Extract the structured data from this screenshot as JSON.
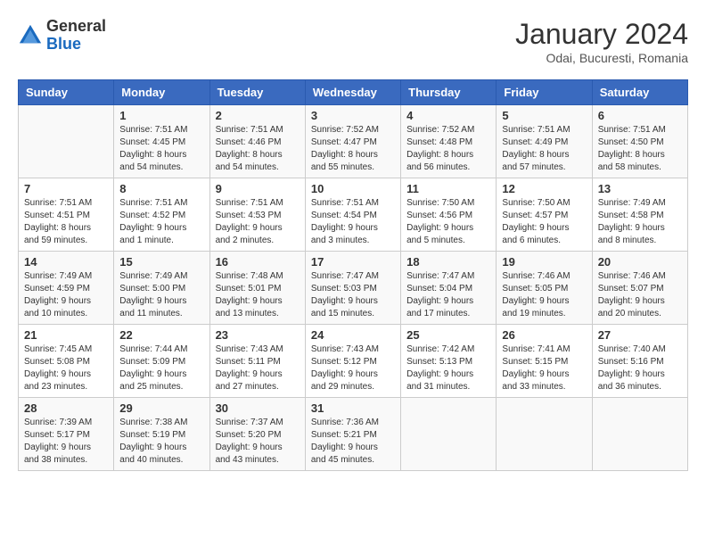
{
  "header": {
    "logo_general": "General",
    "logo_blue": "Blue",
    "month_year": "January 2024",
    "location": "Odai, Bucuresti, Romania"
  },
  "weekdays": [
    "Sunday",
    "Monday",
    "Tuesday",
    "Wednesday",
    "Thursday",
    "Friday",
    "Saturday"
  ],
  "weeks": [
    [
      {
        "day": "",
        "info": ""
      },
      {
        "day": "1",
        "info": "Sunrise: 7:51 AM\nSunset: 4:45 PM\nDaylight: 8 hours\nand 54 minutes."
      },
      {
        "day": "2",
        "info": "Sunrise: 7:51 AM\nSunset: 4:46 PM\nDaylight: 8 hours\nand 54 minutes."
      },
      {
        "day": "3",
        "info": "Sunrise: 7:52 AM\nSunset: 4:47 PM\nDaylight: 8 hours\nand 55 minutes."
      },
      {
        "day": "4",
        "info": "Sunrise: 7:52 AM\nSunset: 4:48 PM\nDaylight: 8 hours\nand 56 minutes."
      },
      {
        "day": "5",
        "info": "Sunrise: 7:51 AM\nSunset: 4:49 PM\nDaylight: 8 hours\nand 57 minutes."
      },
      {
        "day": "6",
        "info": "Sunrise: 7:51 AM\nSunset: 4:50 PM\nDaylight: 8 hours\nand 58 minutes."
      }
    ],
    [
      {
        "day": "7",
        "info": "Sunrise: 7:51 AM\nSunset: 4:51 PM\nDaylight: 8 hours\nand 59 minutes."
      },
      {
        "day": "8",
        "info": "Sunrise: 7:51 AM\nSunset: 4:52 PM\nDaylight: 9 hours\nand 1 minute."
      },
      {
        "day": "9",
        "info": "Sunrise: 7:51 AM\nSunset: 4:53 PM\nDaylight: 9 hours\nand 2 minutes."
      },
      {
        "day": "10",
        "info": "Sunrise: 7:51 AM\nSunset: 4:54 PM\nDaylight: 9 hours\nand 3 minutes."
      },
      {
        "day": "11",
        "info": "Sunrise: 7:50 AM\nSunset: 4:56 PM\nDaylight: 9 hours\nand 5 minutes."
      },
      {
        "day": "12",
        "info": "Sunrise: 7:50 AM\nSunset: 4:57 PM\nDaylight: 9 hours\nand 6 minutes."
      },
      {
        "day": "13",
        "info": "Sunrise: 7:49 AM\nSunset: 4:58 PM\nDaylight: 9 hours\nand 8 minutes."
      }
    ],
    [
      {
        "day": "14",
        "info": "Sunrise: 7:49 AM\nSunset: 4:59 PM\nDaylight: 9 hours\nand 10 minutes."
      },
      {
        "day": "15",
        "info": "Sunrise: 7:49 AM\nSunset: 5:00 PM\nDaylight: 9 hours\nand 11 minutes."
      },
      {
        "day": "16",
        "info": "Sunrise: 7:48 AM\nSunset: 5:01 PM\nDaylight: 9 hours\nand 13 minutes."
      },
      {
        "day": "17",
        "info": "Sunrise: 7:47 AM\nSunset: 5:03 PM\nDaylight: 9 hours\nand 15 minutes."
      },
      {
        "day": "18",
        "info": "Sunrise: 7:47 AM\nSunset: 5:04 PM\nDaylight: 9 hours\nand 17 minutes."
      },
      {
        "day": "19",
        "info": "Sunrise: 7:46 AM\nSunset: 5:05 PM\nDaylight: 9 hours\nand 19 minutes."
      },
      {
        "day": "20",
        "info": "Sunrise: 7:46 AM\nSunset: 5:07 PM\nDaylight: 9 hours\nand 20 minutes."
      }
    ],
    [
      {
        "day": "21",
        "info": "Sunrise: 7:45 AM\nSunset: 5:08 PM\nDaylight: 9 hours\nand 23 minutes."
      },
      {
        "day": "22",
        "info": "Sunrise: 7:44 AM\nSunset: 5:09 PM\nDaylight: 9 hours\nand 25 minutes."
      },
      {
        "day": "23",
        "info": "Sunrise: 7:43 AM\nSunset: 5:11 PM\nDaylight: 9 hours\nand 27 minutes."
      },
      {
        "day": "24",
        "info": "Sunrise: 7:43 AM\nSunset: 5:12 PM\nDaylight: 9 hours\nand 29 minutes."
      },
      {
        "day": "25",
        "info": "Sunrise: 7:42 AM\nSunset: 5:13 PM\nDaylight: 9 hours\nand 31 minutes."
      },
      {
        "day": "26",
        "info": "Sunrise: 7:41 AM\nSunset: 5:15 PM\nDaylight: 9 hours\nand 33 minutes."
      },
      {
        "day": "27",
        "info": "Sunrise: 7:40 AM\nSunset: 5:16 PM\nDaylight: 9 hours\nand 36 minutes."
      }
    ],
    [
      {
        "day": "28",
        "info": "Sunrise: 7:39 AM\nSunset: 5:17 PM\nDaylight: 9 hours\nand 38 minutes."
      },
      {
        "day": "29",
        "info": "Sunrise: 7:38 AM\nSunset: 5:19 PM\nDaylight: 9 hours\nand 40 minutes."
      },
      {
        "day": "30",
        "info": "Sunrise: 7:37 AM\nSunset: 5:20 PM\nDaylight: 9 hours\nand 43 minutes."
      },
      {
        "day": "31",
        "info": "Sunrise: 7:36 AM\nSunset: 5:21 PM\nDaylight: 9 hours\nand 45 minutes."
      },
      {
        "day": "",
        "info": ""
      },
      {
        "day": "",
        "info": ""
      },
      {
        "day": "",
        "info": ""
      }
    ]
  ]
}
